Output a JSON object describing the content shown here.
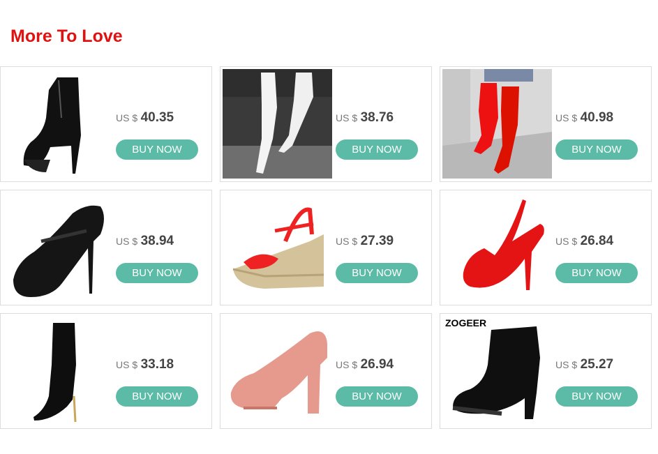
{
  "section": {
    "title": "More To Love"
  },
  "currency_label": "US $",
  "buy_label": "BUY NOW",
  "accent_color": "#e0110f",
  "button_color": "#5bbba6",
  "products": [
    {
      "price": "40.35",
      "image": "black-platform-ankle-boot",
      "brand": ""
    },
    {
      "price": "38.76",
      "image": "white-thigh-high-boots",
      "brand": ""
    },
    {
      "price": "40.98",
      "image": "red-thigh-high-boots",
      "brand": ""
    },
    {
      "price": "38.94",
      "image": "black-mary-jane-pump",
      "brand": ""
    },
    {
      "price": "27.39",
      "image": "red-espadrille-wedge-sandal",
      "brand": ""
    },
    {
      "price": "26.84",
      "image": "red-slingback-peep-toe",
      "brand": ""
    },
    {
      "price": "33.18",
      "image": "black-patent-knee-boot",
      "brand": ""
    },
    {
      "price": "26.94",
      "image": "pink-platform-pump",
      "brand": ""
    },
    {
      "price": "25.27",
      "image": "black-lace-up-ankle-boot",
      "brand": "ZOGEER"
    }
  ]
}
